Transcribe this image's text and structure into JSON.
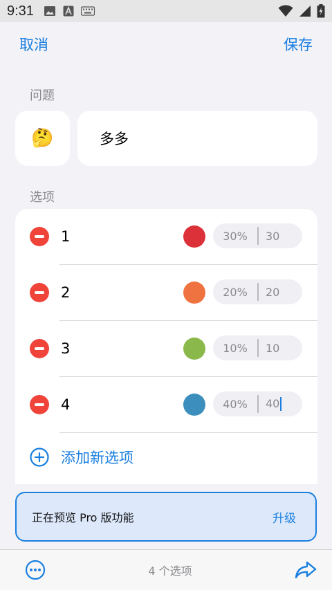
{
  "status_bar": {
    "time": "9:31",
    "icons": [
      "image-icon",
      "text-a-icon",
      "keyboard-icon",
      "wifi-icon",
      "signal-icon",
      "battery-icon"
    ]
  },
  "nav": {
    "cancel_label": "取消",
    "save_label": "保存"
  },
  "question": {
    "section_label": "问题",
    "emoji": "🤔",
    "text": "多多"
  },
  "options": {
    "section_label": "选项",
    "items": [
      {
        "label": "1",
        "color": "#dc3139",
        "percent": "30%",
        "value": "30"
      },
      {
        "label": "2",
        "color": "#ef7340",
        "percent": "20%",
        "value": "20"
      },
      {
        "label": "3",
        "color": "#8bb84a",
        "percent": "10%",
        "value": "10"
      },
      {
        "label": "4",
        "color": "#3c8fbd",
        "percent": "40%",
        "value": "40"
      }
    ],
    "add_label": "添加新选项"
  },
  "pro_banner": {
    "text": "正在预览 Pro 版功能",
    "upgrade_label": "升级"
  },
  "bottom_bar": {
    "count_text": "4 个选项"
  },
  "colors": {
    "accent": "#1a7fe0",
    "remove": "#f0433a"
  }
}
